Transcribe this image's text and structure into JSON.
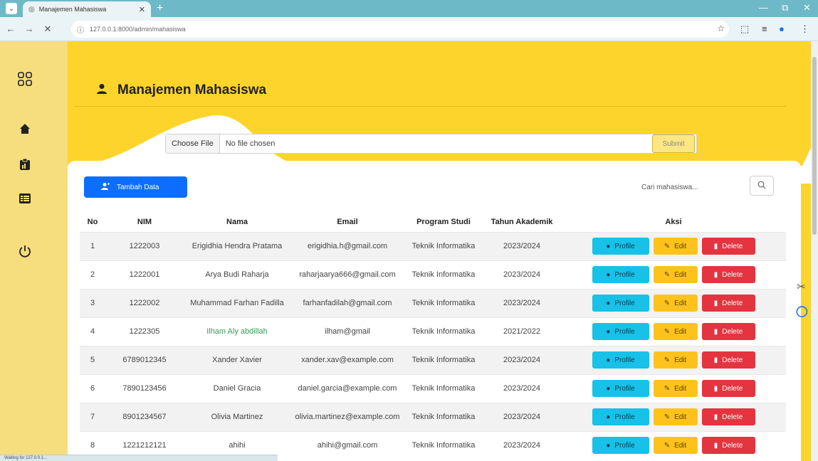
{
  "browser": {
    "tab_title": "Manajemen Mahasiswa",
    "url": "127.0.0.1:8000/admin/mahasiswa"
  },
  "sidebar": {
    "items": [
      {
        "icon": "grid-icon"
      },
      {
        "icon": "home-icon"
      },
      {
        "icon": "clipboard-icon"
      },
      {
        "icon": "list-icon"
      },
      {
        "icon": "power-icon"
      }
    ],
    "status_url": "Waiting for 127.0.0.1..."
  },
  "page": {
    "title": "Manajemen Mahasiswa",
    "upload": {
      "choose_label": "Choose File",
      "file_status": "No file chosen",
      "submit_label": "Submit"
    },
    "add_label": "Tambah Data",
    "search_placeholder": "Cari mahasiswa..."
  },
  "table": {
    "headers": [
      "No",
      "NIM",
      "Nama",
      "Email",
      "Program Studi",
      "Tahun Akademik",
      "Aksi"
    ],
    "rows": [
      {
        "no": "1",
        "nim": "1222003",
        "nama": "Erigidhia Hendra Pratama",
        "email": "erigidhia.h@gmail.com",
        "prodi": "Teknik Informatika",
        "tahun": "2023/2024"
      },
      {
        "no": "2",
        "nim": "1222001",
        "nama": "Arya Budi Raharja",
        "email": "raharjaarya666@gmail.com",
        "prodi": "Teknik Informatika",
        "tahun": "2023/2024"
      },
      {
        "no": "3",
        "nim": "1222002",
        "nama": "Muhammad Farhan Fadilla",
        "email": "farhanfadilah@gmail.com",
        "prodi": "Teknik Informatika",
        "tahun": "2023/2024"
      },
      {
        "no": "4",
        "nim": "1222305",
        "nama": "Ilham Aly abdillah",
        "email": "ilham@gmail",
        "prodi": "Teknik Informatika",
        "tahun": "2021/2022"
      },
      {
        "no": "5",
        "nim": "6789012345",
        "nama": "Xander Xavier",
        "email": "xander.xav@example.com",
        "prodi": "Teknik Informatika",
        "tahun": "2023/2024"
      },
      {
        "no": "6",
        "nim": "7890123456",
        "nama": "Daniel Gracia",
        "email": "daniel.garcia@example.com",
        "prodi": "Teknik Informatika",
        "tahun": "2023/2024"
      },
      {
        "no": "7",
        "nim": "8901234567",
        "nama": "Olivia Martinez",
        "email": "olivia.martinez@example.com",
        "prodi": "Teknik Informatika",
        "tahun": "2023/2024"
      },
      {
        "no": "8",
        "nim": "1221212121",
        "nama": "ahihi",
        "email": "ahihi@gmail.com",
        "prodi": "Teknik Informatika",
        "tahun": "2023/2024"
      }
    ],
    "actions": {
      "profile": "Profile",
      "edit": "Edit",
      "delete": "Delete"
    }
  },
  "colors": {
    "main_bg": "#fdd42b",
    "sidebar_bg": "#f6dd7d",
    "primary": "#0d6efd",
    "info": "#17c1e8",
    "warning": "#fdc31c",
    "danger": "#e4343f"
  }
}
